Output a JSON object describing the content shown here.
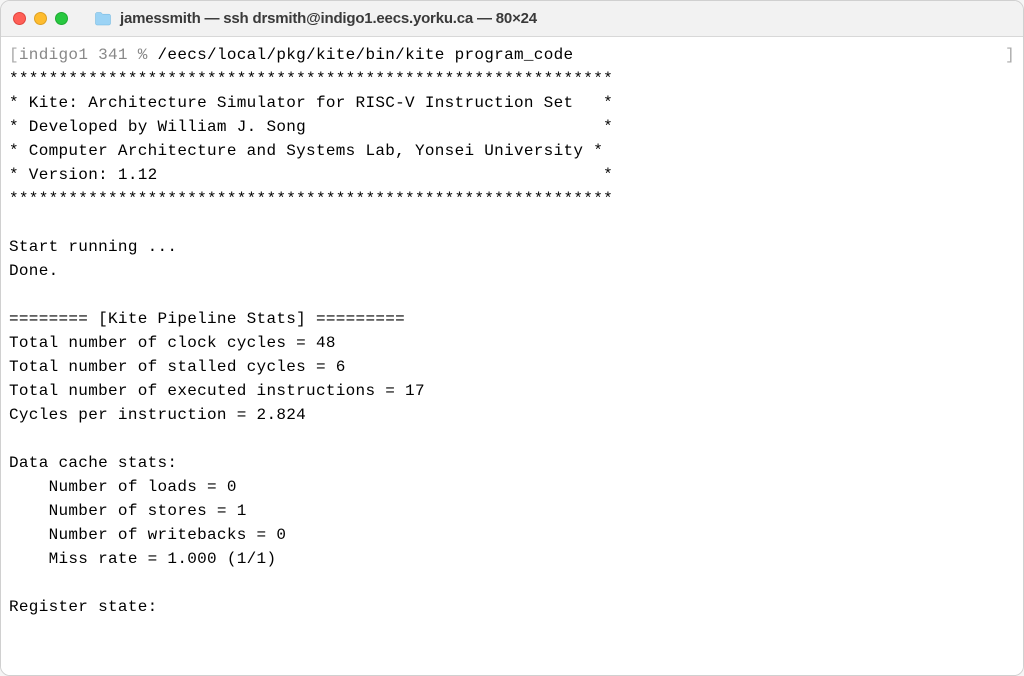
{
  "titlebar": {
    "title": "jamessmith — ssh drsmith@indigo1.eecs.yorku.ca — 80×24"
  },
  "terminal": {
    "prompt_left_bracket": "[",
    "prompt_host": "indigo1 341 % ",
    "prompt_command": "/eecs/local/pkg/kite/bin/kite program_code",
    "prompt_right_bracket": "]",
    "banner_top": "*************************************************************",
    "banner_l1": "* Kite: Architecture Simulator for RISC-V Instruction Set   *",
    "banner_l2": "* Developed by William J. Song                              *",
    "banner_l3": "* Computer Architecture and Systems Lab, Yonsei University *",
    "banner_l4": "* Version: 1.12                                             *",
    "banner_bot": "*************************************************************",
    "blank": "",
    "start": "Start running ...",
    "done": "Done.",
    "stats_header": "======== [Kite Pipeline Stats] =========",
    "clock_cycles": "Total number of clock cycles = 48",
    "stalled_cycles": "Total number of stalled cycles = 6",
    "executed_instr": "Total number of executed instructions = 17",
    "cpi": "Cycles per instruction = 2.824",
    "cache_header": "Data cache stats:",
    "loads": "    Number of loads = 0",
    "stores": "    Number of stores = 1",
    "writebacks": "    Number of writebacks = 0",
    "missrate": "    Miss rate = 1.000 (1/1)",
    "regstate": "Register state:"
  }
}
